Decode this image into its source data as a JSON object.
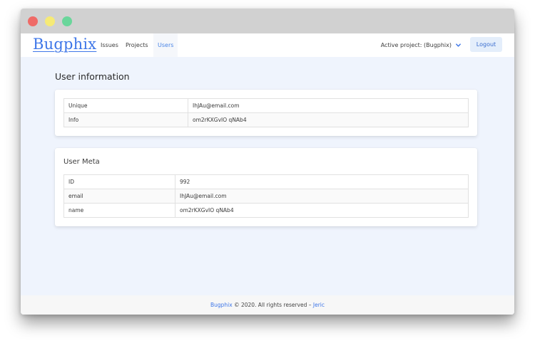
{
  "brand": "Bugphix",
  "nav": {
    "issues": "Issues",
    "projects": "Projects",
    "users": "Users",
    "active_project": "Active project: (Bugphix)",
    "logout": "Logout"
  },
  "page_title": "User information",
  "user_info": [
    {
      "key": "Unique",
      "value": "IhJAu@email.com"
    },
    {
      "key": "Info",
      "value": "om2rKXGvIO qNAb4"
    }
  ],
  "user_meta": {
    "title": "User Meta",
    "rows": [
      {
        "key": "ID",
        "value": "992"
      },
      {
        "key": "email",
        "value": "IhJAu@email.com"
      },
      {
        "key": "name",
        "value": "om2rKXGvIO qNAb4"
      }
    ]
  },
  "footer": {
    "brand": "Bugphix",
    "text": " © 2020. All rights reserved – ",
    "author": "Jeric"
  },
  "colors": {
    "accent": "#3e76e8",
    "page_bg": "#eff4fd",
    "window_close": "#ef6b67",
    "window_minimize": "#f6ea76",
    "window_zoom": "#6ad69b"
  },
  "icons": {
    "project_dropdown": "chevron-down-icon"
  }
}
